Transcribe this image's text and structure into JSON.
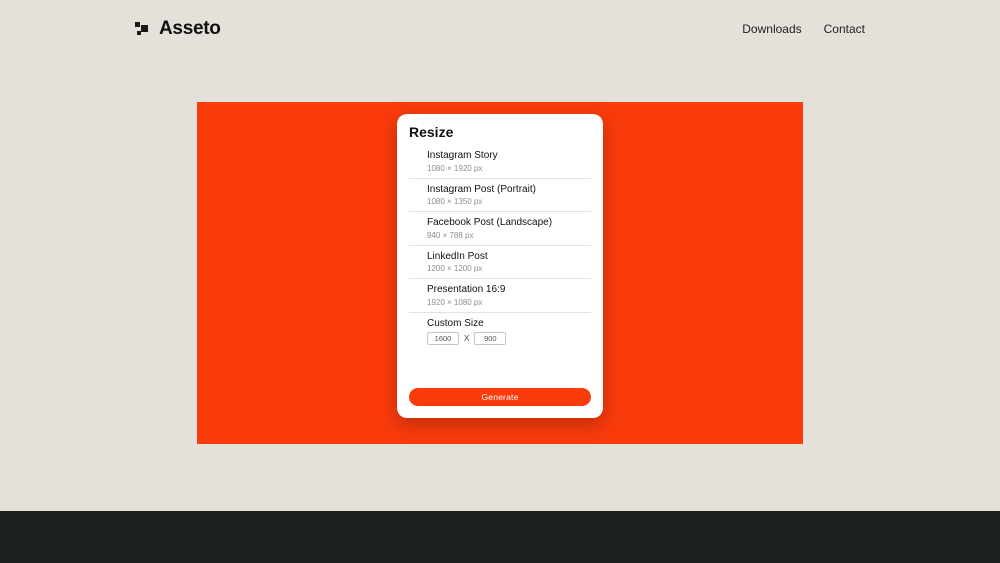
{
  "brand": {
    "name": "Asseto"
  },
  "nav": {
    "downloads": "Downloads",
    "contact": "Contact"
  },
  "card": {
    "title": "Resize",
    "presets": [
      {
        "label": "Instagram Story",
        "dims": "1080 × 1920 px"
      },
      {
        "label": "Instagram Post (Portrait)",
        "dims": "1080 × 1350 px"
      },
      {
        "label": "Facebook Post (Landscape)",
        "dims": "940 × 788 px"
      },
      {
        "label": "LinkedIn Post",
        "dims": "1200 × 1200 px"
      },
      {
        "label": "Presentation 16:9",
        "dims": "1920 × 1080 px"
      }
    ],
    "custom": {
      "label": "Custom Size",
      "width": "1600",
      "height": "900",
      "separator": "X"
    },
    "generate": "Generate"
  },
  "colors": {
    "accent": "#fa3b0c",
    "page_bg": "#e4e1da",
    "footer": "#1c211e"
  }
}
